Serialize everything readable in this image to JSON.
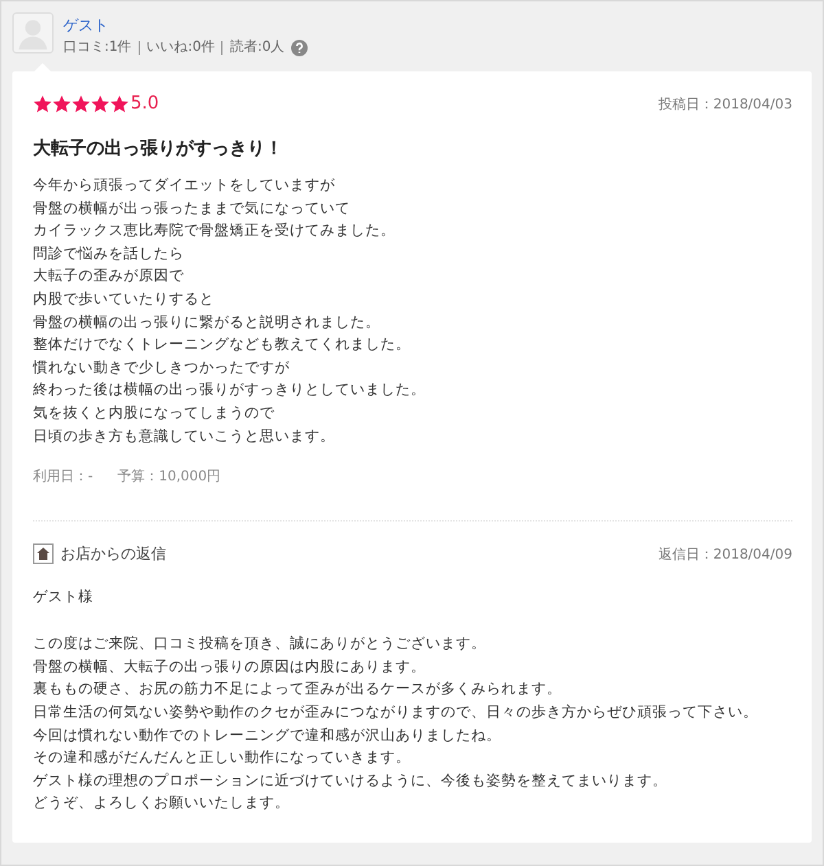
{
  "user": {
    "name": "ゲスト",
    "stats": [
      "口コミ:1件",
      "いいね:0件",
      "読者:0人"
    ]
  },
  "review": {
    "stars": 5,
    "score": "5.0",
    "posted": "投稿日：2018/04/03",
    "title": "大転子の出っ張りがすっきり！",
    "body": [
      "今年から頑張ってダイエットをしていますが",
      "骨盤の横幅が出っ張ったままで気になっていて",
      "カイラックス恵比寿院で骨盤矯正を受けてみました。",
      "問診で悩みを話したら",
      "大転子の歪みが原因で",
      "内股で歩いていたりすると",
      "骨盤の横幅の出っ張りに繋がると説明されました。",
      "整体だけでなくトレーニングなども教えてくれました。",
      "慣れない動きで少しきつかったですが",
      "終わった後は横幅の出っ張りがすっきりとしていました。",
      "気を抜くと内股になってしまうので",
      "日頃の歩き方も意識していこうと思います。"
    ],
    "visit": "利用日：-",
    "budget": "予算：10,000円"
  },
  "reply": {
    "label": "お店からの返信",
    "date": "返信日：2018/04/09",
    "greeting": "ゲスト様",
    "body": [
      "この度はご来院、口コミ投稿を頂き、誠にありがとうございます。",
      "骨盤の横幅、大転子の出っ張りの原因は内股にあります。",
      "裏ももの硬さ、お尻の筋力不足によって歪みが出るケースが多くみられます。",
      "日常生活の何気ない姿勢や動作のクセが歪みにつながりますので、日々の歩き方からぜひ頑張って下さい。",
      "今回は慣れない動作でのトレーニングで違和感が沢山ありましたね。",
      "その違和感がだんだんと正しい動作になっていきます。",
      "ゲスト様の理想のプロポーションに近づけていけるように、今後も姿勢を整えてまいります。",
      "どうぞ、よろしくお願いいたします。"
    ]
  }
}
